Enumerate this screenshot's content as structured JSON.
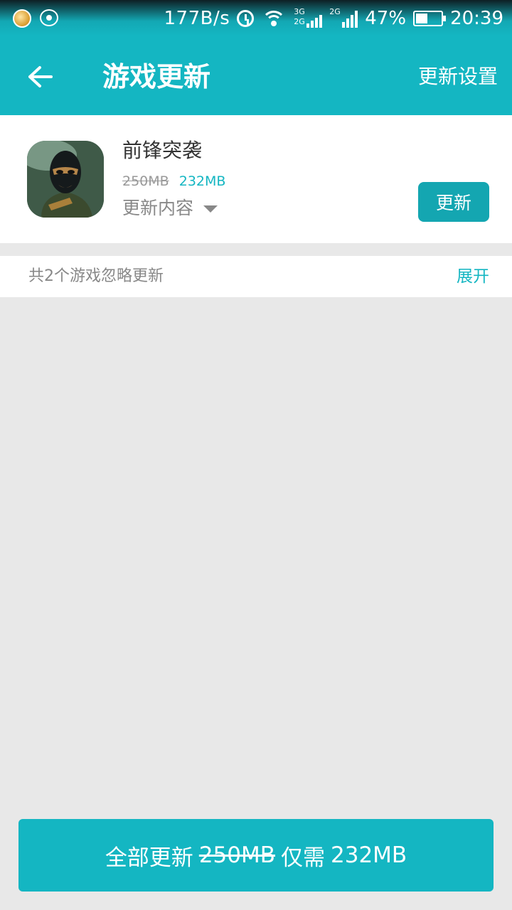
{
  "status_bar": {
    "speed": "177B/s",
    "network_labels": [
      "3G",
      "2G",
      "2G"
    ],
    "battery": "47%",
    "battery_level": 0.47,
    "time": "20:39"
  },
  "app_bar": {
    "title": "游戏更新",
    "settings_label": "更新设置"
  },
  "game_item": {
    "name": "前锋突袭",
    "old_size": "250MB",
    "new_size": "232MB",
    "changelog_label": "更新内容",
    "update_label": "更新"
  },
  "ignored": {
    "text": "共2个游戏忽略更新",
    "expand_label": "展开"
  },
  "update_all": {
    "prefix": "全部更新",
    "old_size": "250MB",
    "mid": "仅需",
    "new_size": "232MB"
  },
  "colors": {
    "accent": "#14b6c2",
    "button": "#14a6b1",
    "background": "#e8e8e8"
  }
}
